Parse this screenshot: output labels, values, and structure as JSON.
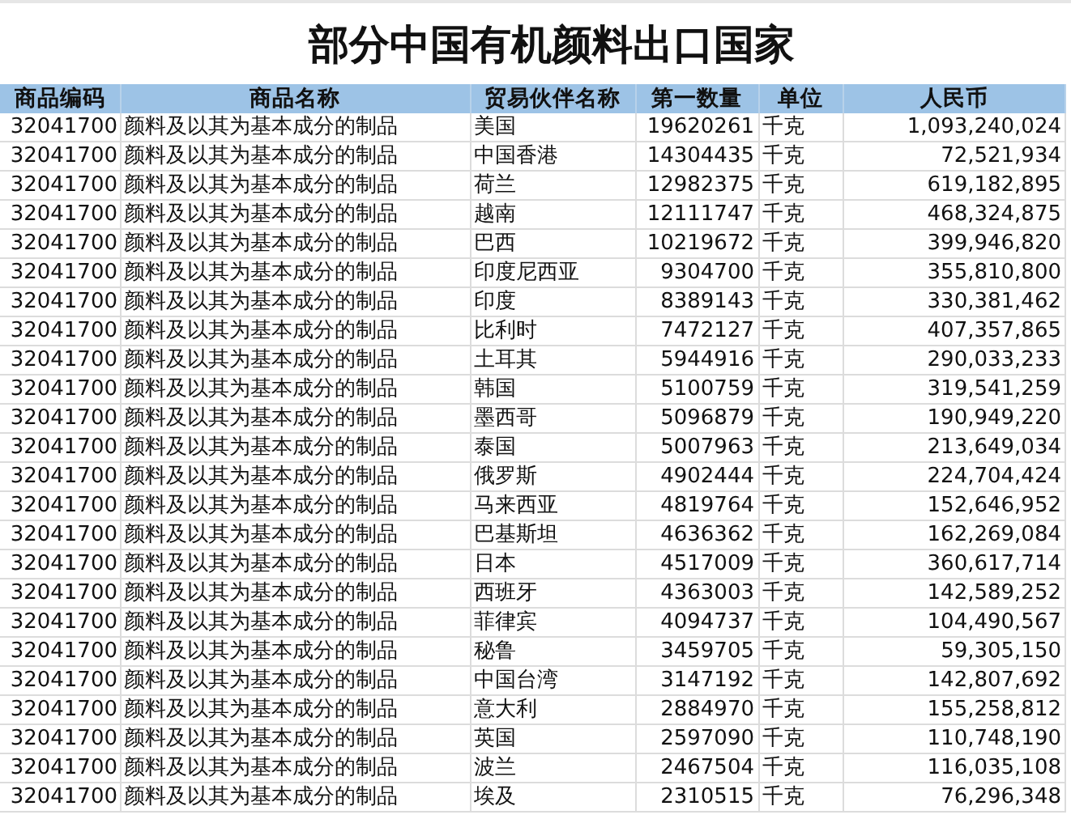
{
  "title": "部分中国有机颜料出口国家",
  "table": {
    "columns": [
      "商品编码",
      "商品名称",
      "贸易伙伴名称",
      "第一数量",
      "单位",
      "人民币"
    ],
    "rows": [
      [
        "32041700",
        "颜料及以其为基本成分的制品",
        "美国",
        "19620261",
        "千克",
        "1,093,240,024"
      ],
      [
        "32041700",
        "颜料及以其为基本成分的制品",
        "中国香港",
        "14304435",
        "千克",
        "72,521,934"
      ],
      [
        "32041700",
        "颜料及以其为基本成分的制品",
        "荷兰",
        "12982375",
        "千克",
        "619,182,895"
      ],
      [
        "32041700",
        "颜料及以其为基本成分的制品",
        "越南",
        "12111747",
        "千克",
        "468,324,875"
      ],
      [
        "32041700",
        "颜料及以其为基本成分的制品",
        "巴西",
        "10219672",
        "千克",
        "399,946,820"
      ],
      [
        "32041700",
        "颜料及以其为基本成分的制品",
        "印度尼西亚",
        "9304700",
        "千克",
        "355,810,800"
      ],
      [
        "32041700",
        "颜料及以其为基本成分的制品",
        "印度",
        "8389143",
        "千克",
        "330,381,462"
      ],
      [
        "32041700",
        "颜料及以其为基本成分的制品",
        "比利时",
        "7472127",
        "千克",
        "407,357,865"
      ],
      [
        "32041700",
        "颜料及以其为基本成分的制品",
        "土耳其",
        "5944916",
        "千克",
        "290,033,233"
      ],
      [
        "32041700",
        "颜料及以其为基本成分的制品",
        "韩国",
        "5100759",
        "千克",
        "319,541,259"
      ],
      [
        "32041700",
        "颜料及以其为基本成分的制品",
        "墨西哥",
        "5096879",
        "千克",
        "190,949,220"
      ],
      [
        "32041700",
        "颜料及以其为基本成分的制品",
        "泰国",
        "5007963",
        "千克",
        "213,649,034"
      ],
      [
        "32041700",
        "颜料及以其为基本成分的制品",
        "俄罗斯",
        "4902444",
        "千克",
        "224,704,424"
      ],
      [
        "32041700",
        "颜料及以其为基本成分的制品",
        "马来西亚",
        "4819764",
        "千克",
        "152,646,952"
      ],
      [
        "32041700",
        "颜料及以其为基本成分的制品",
        "巴基斯坦",
        "4636362",
        "千克",
        "162,269,084"
      ],
      [
        "32041700",
        "颜料及以其为基本成分的制品",
        "日本",
        "4517009",
        "千克",
        "360,617,714"
      ],
      [
        "32041700",
        "颜料及以其为基本成分的制品",
        "西班牙",
        "4363003",
        "千克",
        "142,589,252"
      ],
      [
        "32041700",
        "颜料及以其为基本成分的制品",
        "菲律宾",
        "4094737",
        "千克",
        "104,490,567"
      ],
      [
        "32041700",
        "颜料及以其为基本成分的制品",
        "秘鲁",
        "3459705",
        "千克",
        "59,305,150"
      ],
      [
        "32041700",
        "颜料及以其为基本成分的制品",
        "中国台湾",
        "3147192",
        "千克",
        "142,807,692"
      ],
      [
        "32041700",
        "颜料及以其为基本成分的制品",
        "意大利",
        "2884970",
        "千克",
        "155,258,812"
      ],
      [
        "32041700",
        "颜料及以其为基本成分的制品",
        "英国",
        "2597090",
        "千克",
        "110,748,190"
      ],
      [
        "32041700",
        "颜料及以其为基本成分的制品",
        "波兰",
        "2467504",
        "千克",
        "116,035,108"
      ],
      [
        "32041700",
        "颜料及以其为基本成分的制品",
        "埃及",
        "2310515",
        "千克",
        "76,296,348"
      ]
    ]
  }
}
